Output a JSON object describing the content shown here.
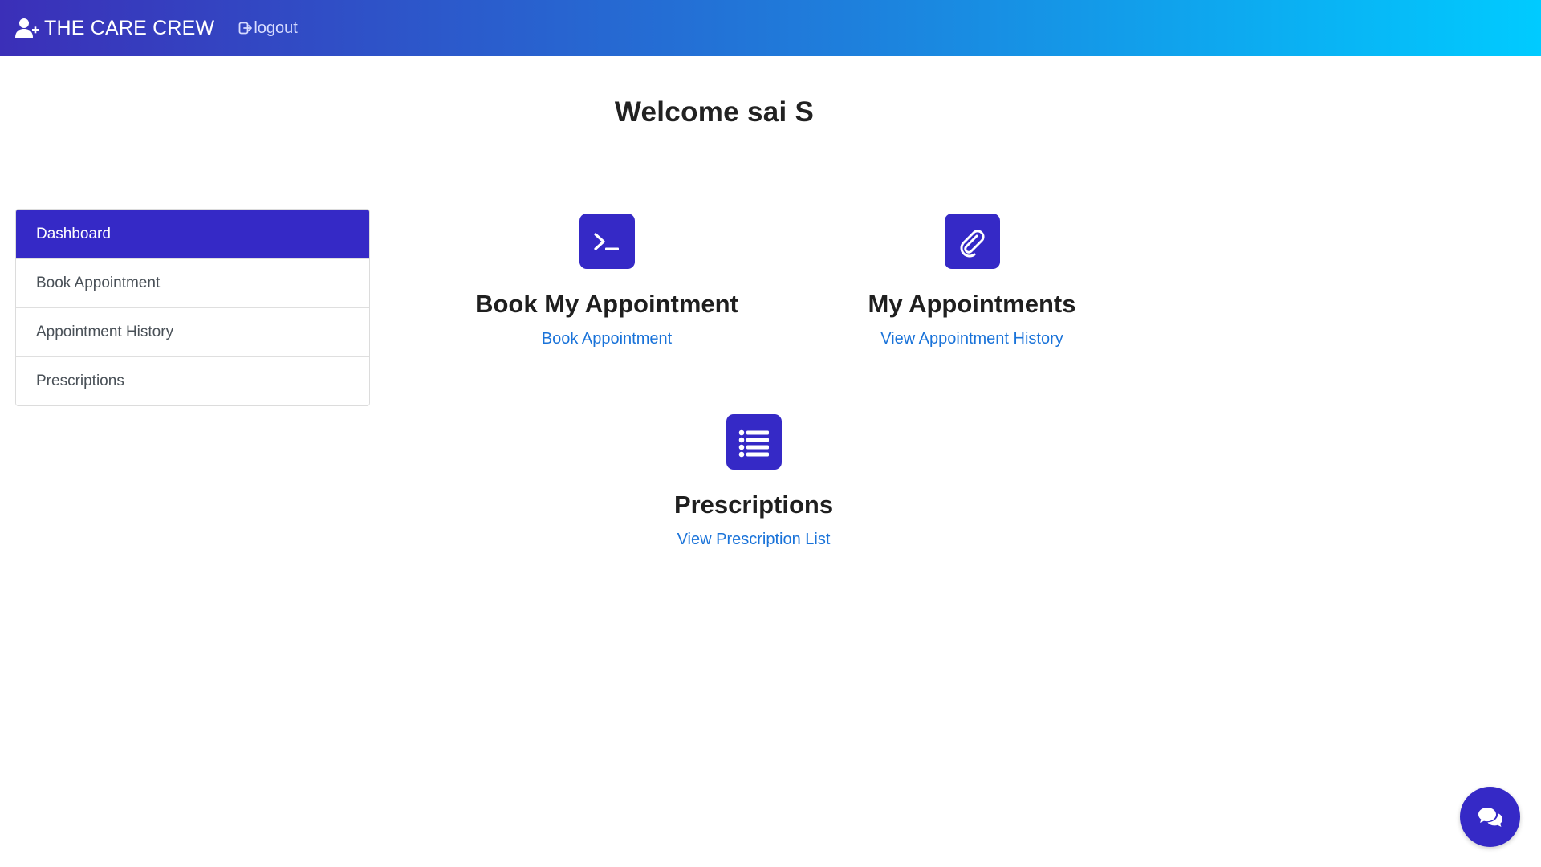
{
  "navbar": {
    "brand": "THE CARE CREW",
    "logout": "logout",
    "gradient_colors": [
      "#3b2fb8",
      "#1e7fdc",
      "#00cbff"
    ]
  },
  "welcome": {
    "text": "Welcome  sai S"
  },
  "sidebar": {
    "items": [
      {
        "label": "Dashboard",
        "active": true
      },
      {
        "label": "Book Appointment",
        "active": false
      },
      {
        "label": "Appointment History",
        "active": false
      },
      {
        "label": "Prescriptions",
        "active": false
      }
    ],
    "active_color": "#3529c6"
  },
  "cards": [
    {
      "icon": "terminal-icon",
      "title": "Book My Appointment",
      "link": "Book Appointment"
    },
    {
      "icon": "paperclip-icon",
      "title": "My Appointments",
      "link": "View Appointment History"
    },
    {
      "icon": "list-icon",
      "title": "Prescriptions",
      "link": "View Prescription List"
    }
  ],
  "chat": {
    "icon": "chat-bubbles-icon",
    "color": "#3529c6"
  },
  "colors": {
    "accent": "#3529c6",
    "link": "#1a73d9"
  }
}
